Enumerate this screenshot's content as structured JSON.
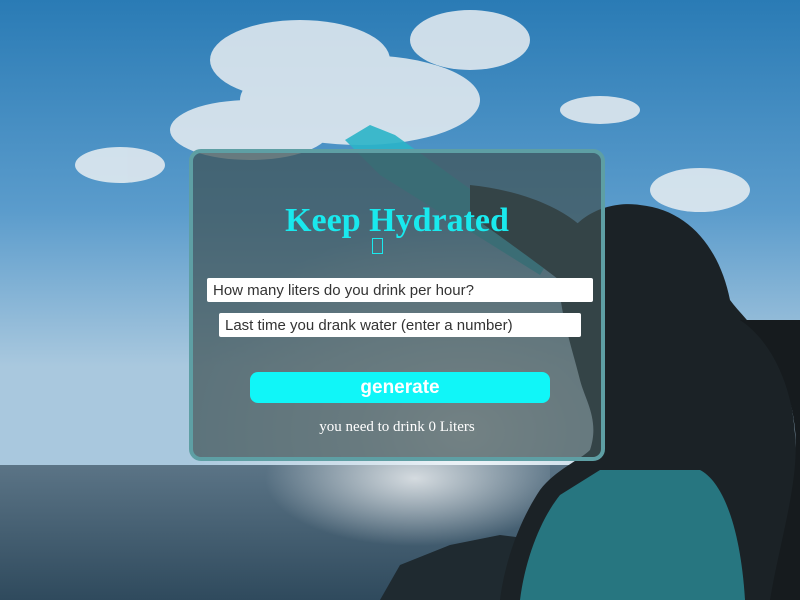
{
  "card": {
    "title": "Keep Hydrated",
    "rate_placeholder": "How many liters do you drink per hour?",
    "last_placeholder": "Last time you drank water (enter a number)",
    "generate_label": "generate",
    "result_text": "you need to drink 0 Liters"
  },
  "colors": {
    "accent": "#19e9ee",
    "button": "#10f6f8",
    "card_border": "#5e9fa4"
  },
  "icons": {
    "missing_glyph": "missing-glyph-icon"
  }
}
